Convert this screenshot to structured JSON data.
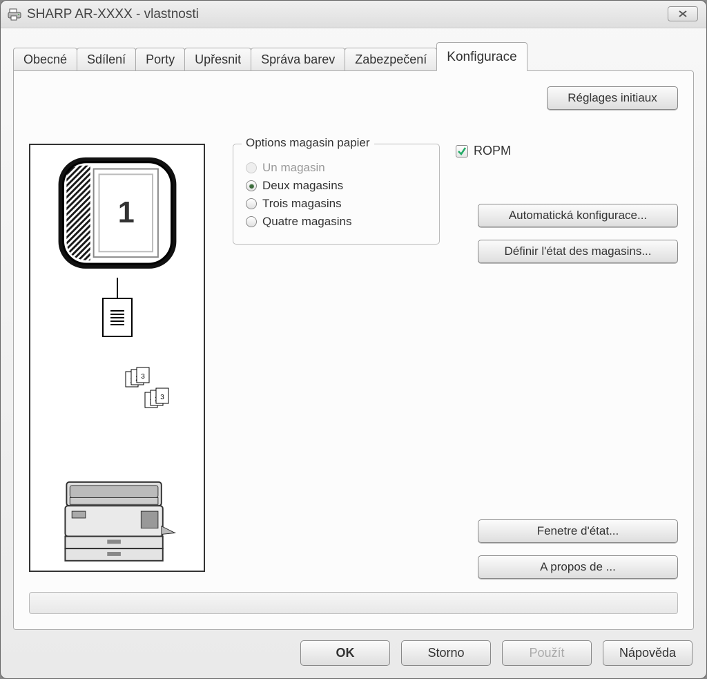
{
  "window": {
    "title": "SHARP AR-XXXX - vlastnosti"
  },
  "tabs": [
    {
      "label": "Obecné"
    },
    {
      "label": "Sdílení"
    },
    {
      "label": "Porty"
    },
    {
      "label": "Upřesnit"
    },
    {
      "label": "Správa barev"
    },
    {
      "label": "Zabezpečení"
    },
    {
      "label": "Konfigurace"
    }
  ],
  "active_tab_index": 6,
  "panel": {
    "initial_settings_btn": "Réglages initiaux",
    "tray_number": "1",
    "group_title": "Options magasin papier",
    "radios": [
      {
        "label": "Un magasin",
        "disabled": true,
        "selected": false
      },
      {
        "label": "Deux magasins",
        "disabled": false,
        "selected": true
      },
      {
        "label": "Trois magasins",
        "disabled": false,
        "selected": false
      },
      {
        "label": "Quatre magasins",
        "disabled": false,
        "selected": false
      }
    ],
    "ropm_label": "ROPM",
    "ropm_checked": true,
    "auto_config_btn": "Automatická konfigurace...",
    "define_tray_btn": "Définir l'état des magasins...",
    "status_window_btn": "Fenetre d'état...",
    "about_btn": "A propos de ..."
  },
  "dialog_buttons": {
    "ok": "OK",
    "cancel": "Storno",
    "apply": "Použít",
    "help": "Nápověda"
  }
}
